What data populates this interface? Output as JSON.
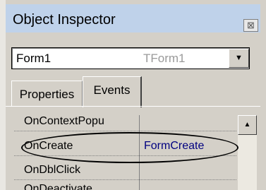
{
  "window": {
    "title": "Object Inspector",
    "close_icon": "close-icon",
    "close_glyph": "⊠"
  },
  "component_selector": {
    "name": "Form1",
    "type": "TForm1",
    "dropdown_icon": "chevron-down-icon",
    "dropdown_glyph": "▼"
  },
  "tabs": [
    {
      "label": "Properties",
      "selected": false
    },
    {
      "label": "Events",
      "selected": true
    }
  ],
  "events": [
    {
      "name": "OnContextPopu",
      "value": ""
    },
    {
      "name": "OnCreate",
      "value": "FormCreate",
      "highlighted": true
    },
    {
      "name": "OnDblClick",
      "value": ""
    },
    {
      "name": "OnDeactivate",
      "value": ""
    }
  ],
  "scrollbar": {
    "up_icon": "scroll-up-icon",
    "up_glyph": "▲"
  },
  "colors": {
    "title_bar": "#bfd2ea",
    "panel": "#d4d0c8",
    "event_value": "#000080",
    "annotation": "#000000"
  }
}
